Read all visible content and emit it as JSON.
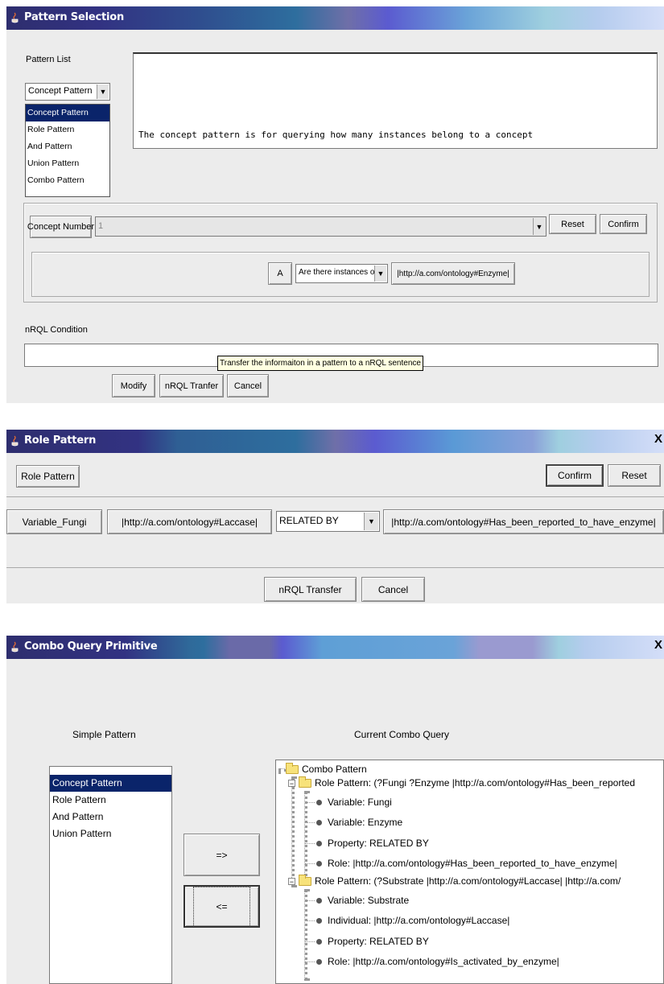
{
  "pattern_selection": {
    "title": "Pattern Selection",
    "pattern_list_label": "Pattern List",
    "selected_pattern": "Concept Pattern",
    "pattern_options": [
      "Concept Pattern",
      "Role Pattern",
      "And Pattern",
      "Union Pattern",
      "Combo Pattern"
    ],
    "description": "The concept pattern is for querying how many instances belong to a concept",
    "concept_number_label": "Concept Number",
    "concept_number_value": "1",
    "reset_label": "Reset",
    "confirm_label": "Confirm",
    "variable_label": "A",
    "query_type_value": "Are there instances of",
    "concept_value": "|http://a.com/ontology#Enzyme|",
    "nrql_condition_label": "nRQL Condition",
    "tooltip": "Transfer the informaiton in a pattern to a nRQL sentence",
    "modify_label": "Modify",
    "nrql_transfer_label": "nRQL Tranfer",
    "cancel_label": "Cancel"
  },
  "role_pattern": {
    "title": "Role Pattern",
    "close_label": "X",
    "role_pattern_button": "Role Pattern",
    "confirm_label": "Confirm",
    "reset_label": "Reset",
    "variable_button": "Variable_Fungi",
    "individual_button": "|http://a.com/ontology#Laccase|",
    "relation_value": "RELATED BY",
    "property_button": "|http://a.com/ontology#Has_been_reported_to_have_enzyme|",
    "nrql_transfer_label": "nRQL Transfer",
    "cancel_label": "Cancel"
  },
  "combo_query": {
    "title": "Combo Query Primitive",
    "close_label": "X",
    "simple_pattern_label": "Simple Pattern",
    "current_combo_label": "Current Combo Query",
    "simple_patterns": [
      "Concept Pattern",
      "Role Pattern",
      "And Pattern",
      "Union Pattern"
    ],
    "selected_simple_pattern": "Concept Pattern",
    "add_button": "=>",
    "remove_button": "<=",
    "tree": {
      "root": "Combo Pattern",
      "nodes": [
        {
          "label": "Role Pattern: (?Fungi ?Enzyme |http://a.com/ontology#Has_been_reported",
          "children": [
            "Variable: Fungi",
            "Variable: Enzyme",
            "Property: RELATED BY",
            "Role: |http://a.com/ontology#Has_been_reported_to_have_enzyme|"
          ]
        },
        {
          "label": "Role Pattern: (?Substrate |http://a.com/ontology#Laccase| |http://a.com/",
          "children": [
            "Variable: Substrate",
            "Individual: |http://a.com/ontology#Laccase|",
            "Property: RELATED BY",
            "Role: |http://a.com/ontology#Is_activated_by_enzyme|"
          ]
        }
      ]
    }
  }
}
